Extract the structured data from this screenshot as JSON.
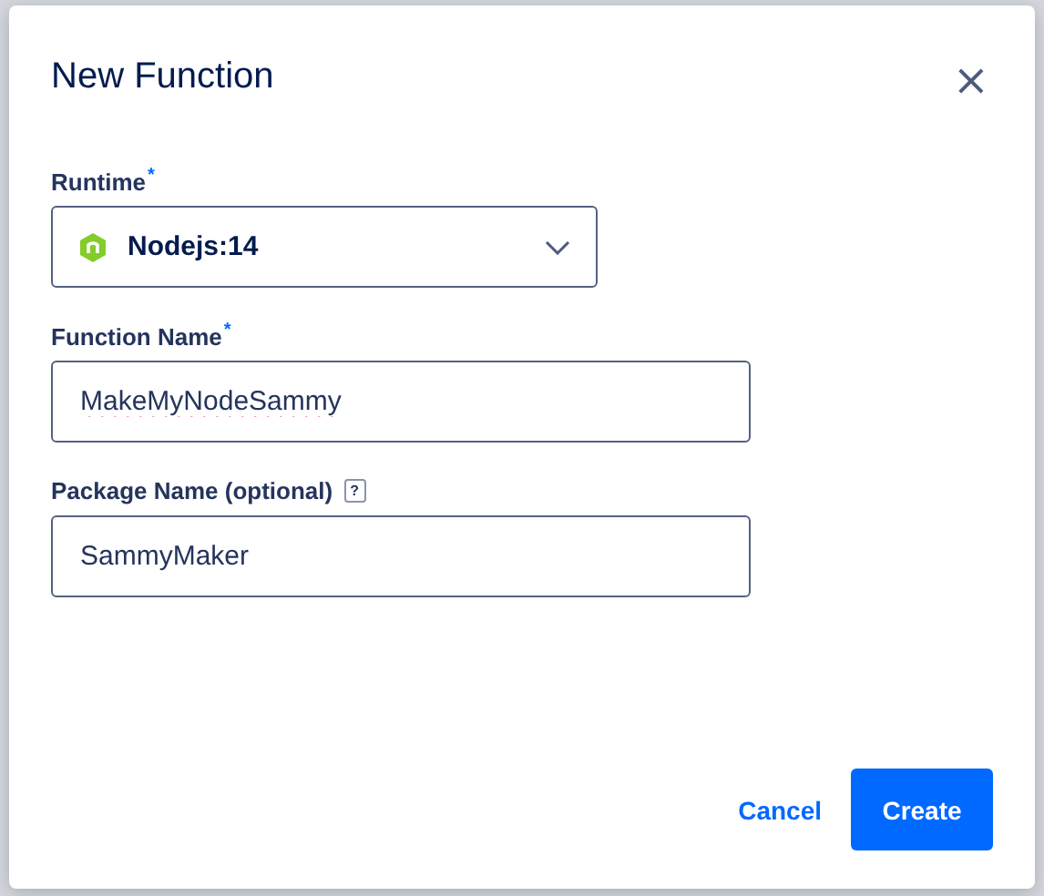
{
  "dialog": {
    "title": "New Function",
    "close": "×"
  },
  "fields": [
    {
      "kind": "select",
      "label": "Runtime",
      "required_mark": "*",
      "value": "Nodejs:14"
    },
    {
      "kind": "text",
      "label": "Function Name",
      "required_mark": "*",
      "value": "MakeMyNodeSammy",
      "misspelled": true
    },
    {
      "kind": "text",
      "label": "Package Name (optional)",
      "help": "?",
      "value": "SammyMaker",
      "misspelled": false
    }
  ],
  "buttons": [
    {
      "kind": "link",
      "label": "Cancel"
    },
    {
      "kind": "primary",
      "label": "Create"
    }
  ]
}
